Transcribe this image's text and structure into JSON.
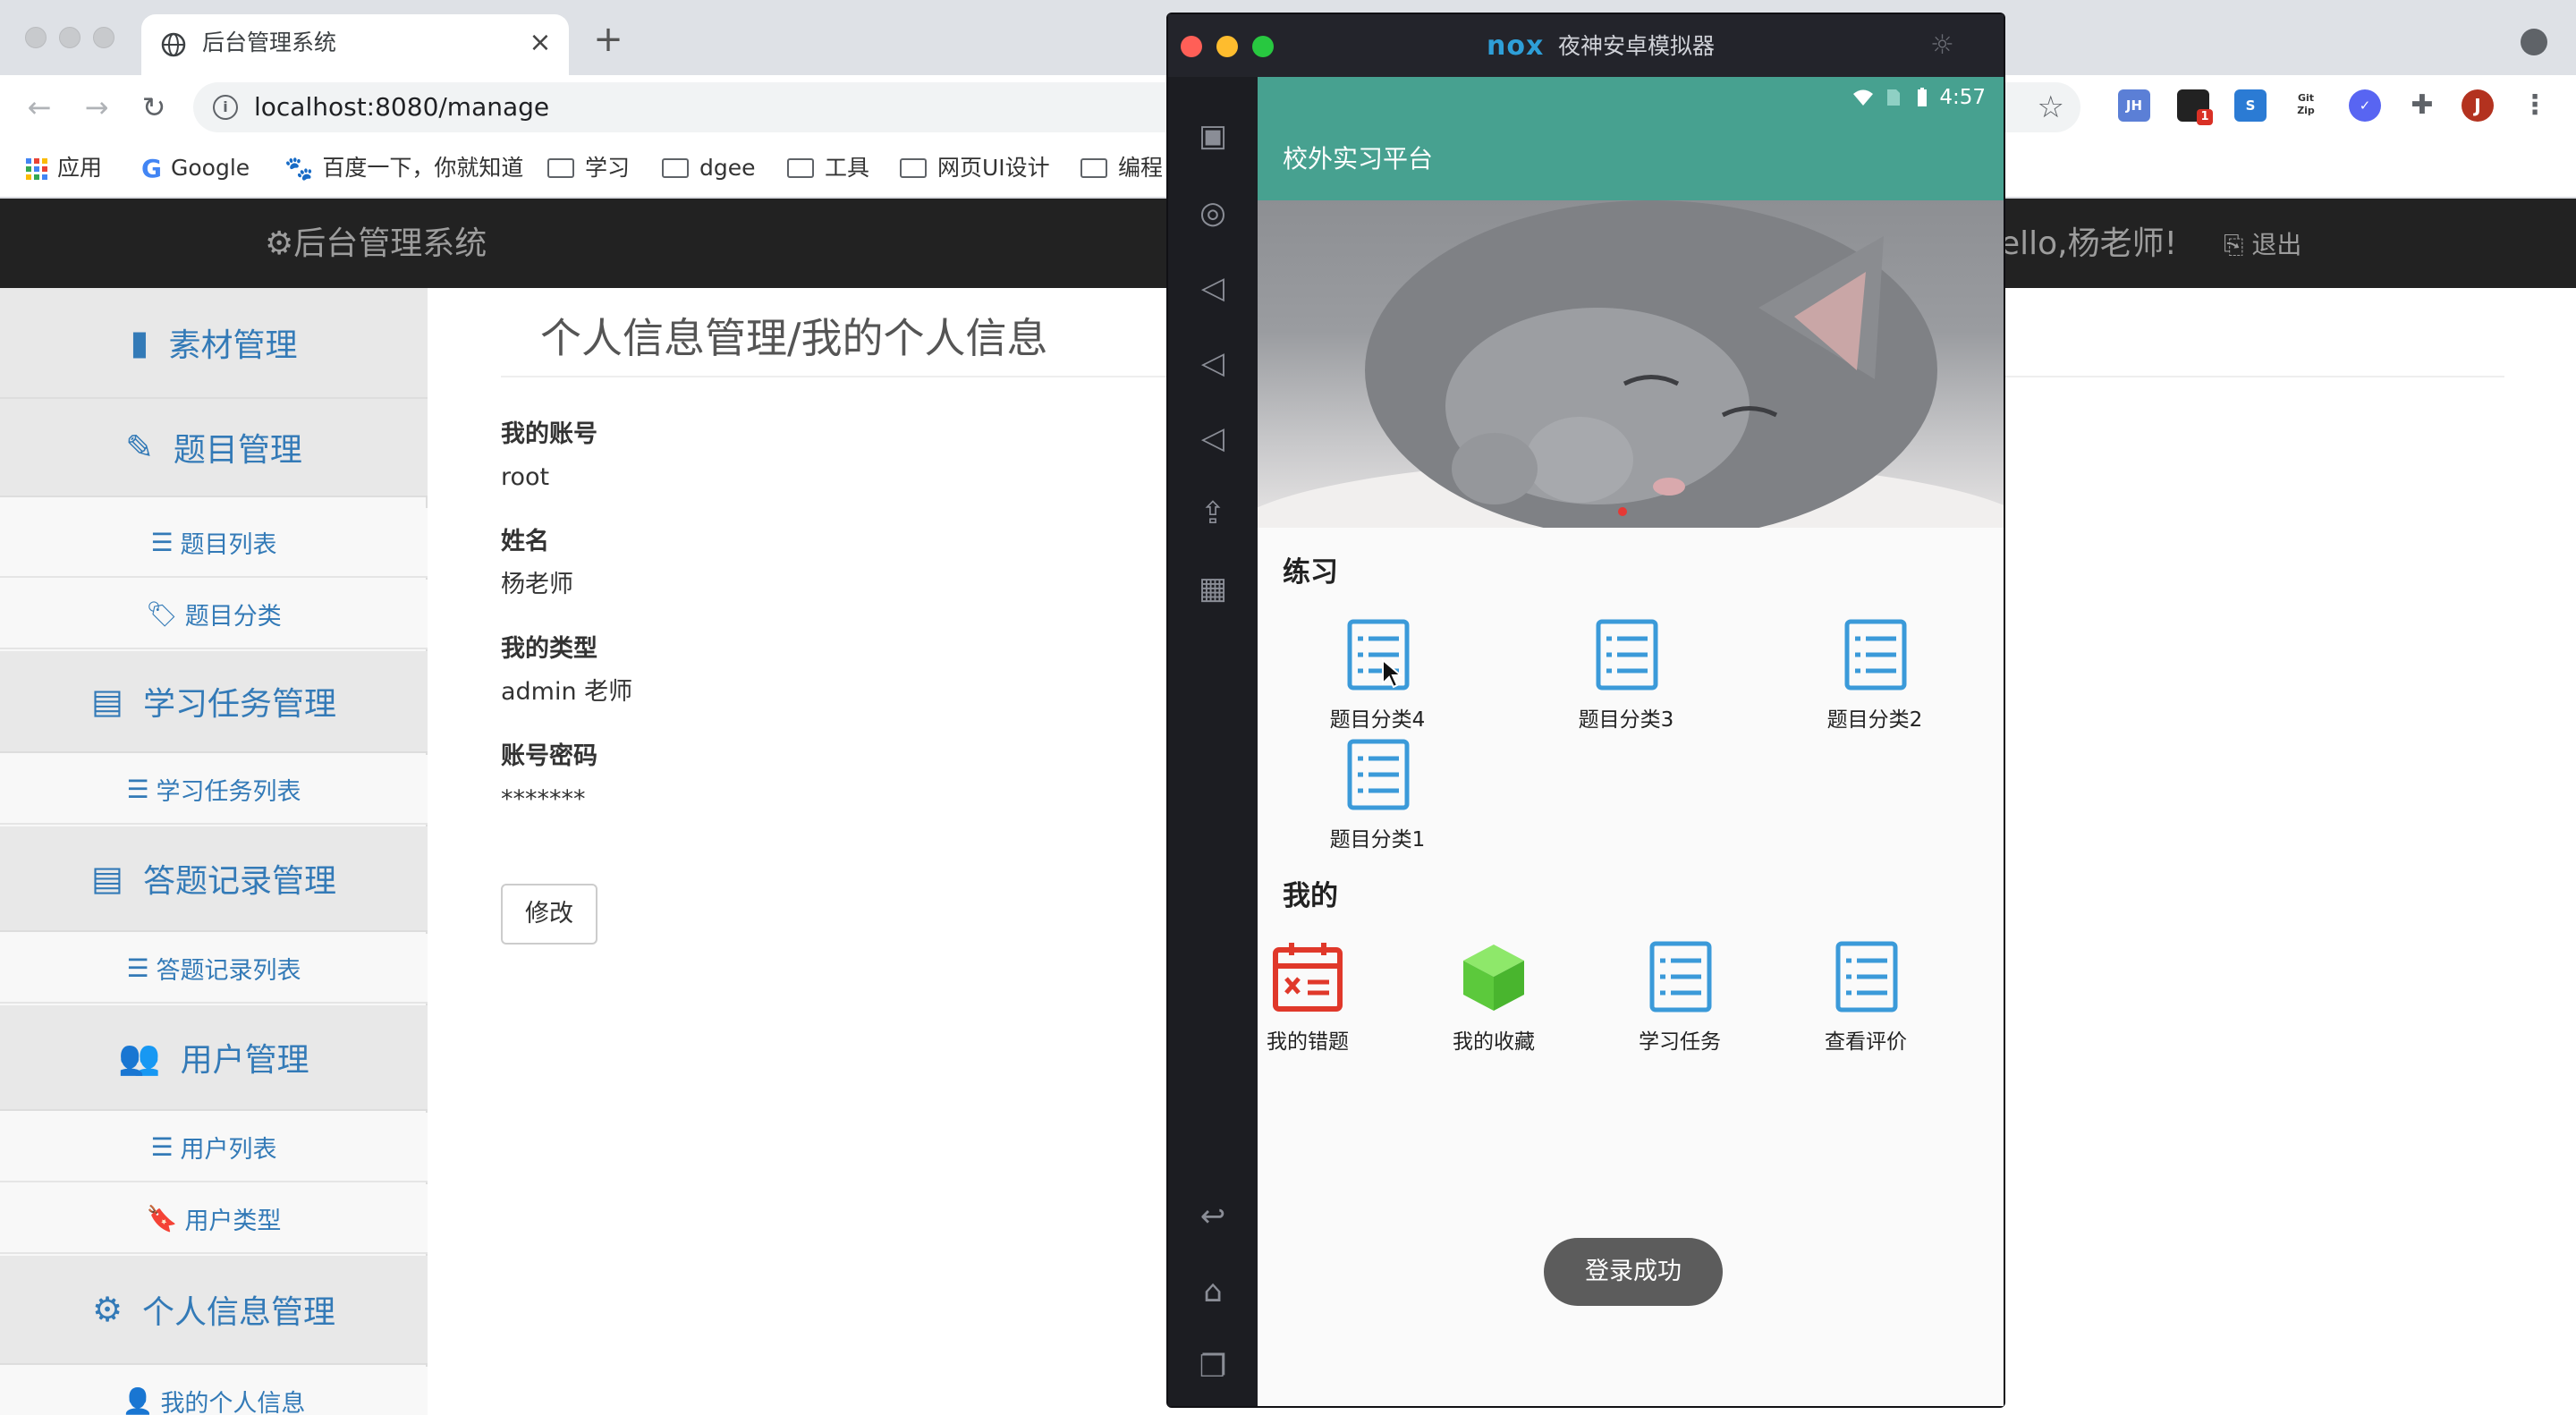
{
  "browser": {
    "tab_title": "后台管理系统",
    "new_tab": "+",
    "close_tab": "×",
    "url": "localhost:8080/manage",
    "extensions": [
      "JH",
      "1",
      "S",
      "Git Zip"
    ],
    "profile": "J",
    "bookmarks": [
      "应用",
      "Google",
      "百度一下，你就知道",
      "学习",
      "dgee",
      "工具",
      "网页UI设计",
      "编程"
    ]
  },
  "admin": {
    "brand": "后台管理系统",
    "hello": "ello,杨老师!",
    "logout": "退出",
    "sidebar": {
      "materials": "素材管理",
      "questions": "题目管理",
      "question_list": "题目列表",
      "question_category": "题目分类",
      "tasks": "学习任务管理",
      "task_list": "学习任务列表",
      "records": "答题记录管理",
      "record_list": "答题记录列表",
      "users": "用户管理",
      "user_list": "用户列表",
      "user_types": "用户类型",
      "profile": "个人信息管理",
      "my_profile": "我的个人信息"
    },
    "page_title": "个人信息管理/我的个人信息",
    "fields": {
      "account_label": "我的账号",
      "account_value": "root",
      "name_label": "姓名",
      "name_value": "杨老师",
      "type_label": "我的类型",
      "type_value": "admin 老师",
      "password_label": "账号密码",
      "password_value": "*******"
    },
    "edit_button": "修改"
  },
  "emulator": {
    "logo": "nox",
    "title": "夜神安卓模拟器",
    "phone": {
      "time": "4:57",
      "app_title": "校外实习平台",
      "practice_heading": "练习",
      "practice_items": [
        "题目分类4",
        "题目分类3",
        "题目分类2",
        "题目分类1"
      ],
      "mine_heading": "我的",
      "mine_items": [
        "我的错题",
        "我的收藏",
        "学习任务",
        "查看评价"
      ],
      "toast": "登录成功"
    }
  },
  "colors": {
    "phone_accent": "#47a190",
    "link_blue": "#337ab7",
    "admin_header": "#222222",
    "doc_icon": "#3b9ad9",
    "wrong_icon": "#e0382a",
    "fav_icon": "#6cd34a"
  }
}
